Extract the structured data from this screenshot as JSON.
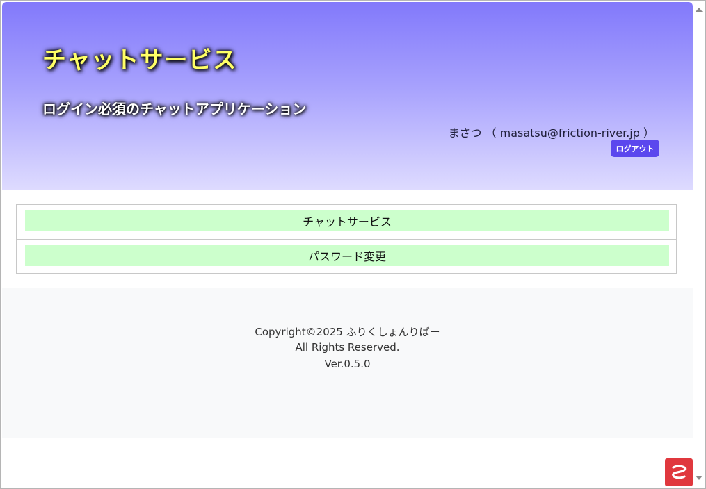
{
  "header": {
    "title": "チャットサービス",
    "subtitle": "ログイン必須のチャットアプリケーション",
    "user_name": "まさつ",
    "user_email": "masatsu@friction-river.jp",
    "user_display": "まさつ （ masatsu@friction-river.jp ）",
    "logout_label": "ログアウト"
  },
  "menu": {
    "items": [
      {
        "label": "チャットサービス"
      },
      {
        "label": "パスワード変更"
      }
    ]
  },
  "footer": {
    "copyright": "Copyright©2025 ふりくしょんりばー",
    "rights": "All Rights Reserved.",
    "version": "Ver.0.5.0"
  },
  "colors": {
    "header_gradient_top": "#8279fb",
    "header_gradient_bottom": "#dedbff",
    "title_color": "#ffff66",
    "logout_button": "#5b47ee",
    "menu_item_bg": "#ccffcc",
    "footer_bg": "#f8f9fa",
    "badge": "#e0383e"
  },
  "icons": {
    "corner_badge": "app-badge-icon",
    "scroll_up": "scroll-up-arrow-icon",
    "scroll_down": "scroll-down-arrow-icon"
  }
}
